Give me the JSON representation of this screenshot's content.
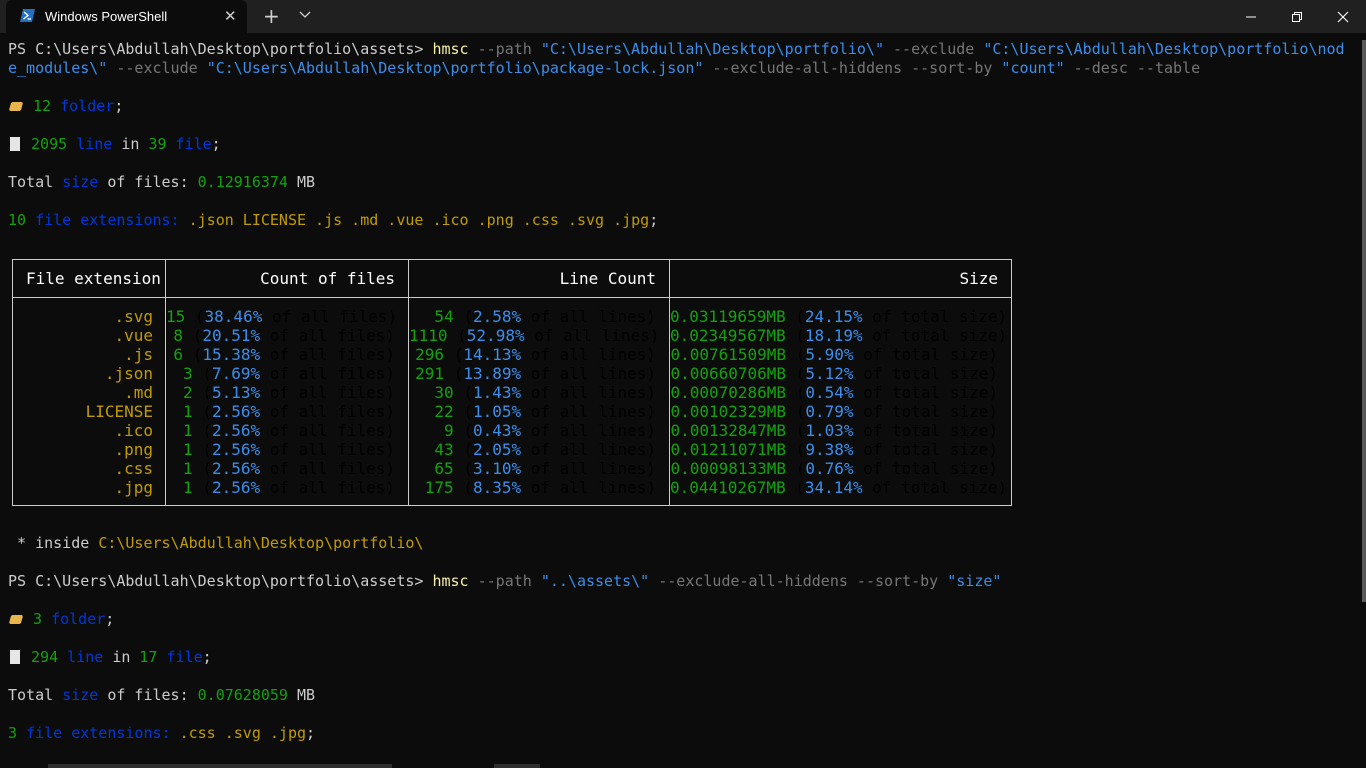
{
  "window": {
    "tab_title": "Windows PowerShell",
    "tab_close": "✕",
    "new_tab": "+",
    "accent": "#0c0c0c"
  },
  "cmd1": {
    "prompt": "PS C:\\Users\\Abdullah\\Desktop\\portfolio\\assets>",
    "command": "hmsc",
    "p1": "--path",
    "v1": "\"C:\\Users\\Abdullah\\Desktop\\portfolio\\\"",
    "p2": "--exclude",
    "v2a": "\"C:\\Users\\Abdullah\\Desktop\\portfolio\\nod",
    "v2b": "e_modules\\\"",
    "p3": "--exclude",
    "v3": "\"C:\\Users\\Abdullah\\Desktop\\portfolio\\package-lock.json\"",
    "p4": "--exclude-all-hiddens --sort-by",
    "v4": "\"count\"",
    "p5": "--desc --table"
  },
  "out1": {
    "folders_count": "12",
    "folders_word": "folder",
    "lines_count": "2095",
    "lines_word": "line",
    "in_word": "in",
    "files_count": "39",
    "files_word": "file",
    "total_a": "Total",
    "total_size_word": "size",
    "total_b": "of files:",
    "total_value": "0.12916374",
    "total_unit": "MB",
    "ext_count": "10",
    "ext_label": "file extensions:",
    "ext_list": ".json LICENSE .js .md .vue .ico .png .css .svg .jpg"
  },
  "table": {
    "headers": [
      "File extension",
      "Count of files",
      "Line Count",
      "Size"
    ],
    "rows": [
      {
        "ext": ".svg",
        "count": "15",
        "count_pct": "38.46%",
        "lines": "54",
        "lines_pct": "2.58%",
        "size": "0.03119659MB",
        "size_pct": "24.15%"
      },
      {
        "ext": ".vue",
        "count": "8",
        "count_pct": "20.51%",
        "lines": "1110",
        "lines_pct": "52.98%",
        "size": "0.02349567MB",
        "size_pct": "18.19%"
      },
      {
        "ext": ".js",
        "count": "6",
        "count_pct": "15.38%",
        "lines": "296",
        "lines_pct": "14.13%",
        "size": "0.00761509MB",
        "size_pct": "5.90%"
      },
      {
        "ext": ".json",
        "count": "3",
        "count_pct": "7.69%",
        "lines": "291",
        "lines_pct": "13.89%",
        "size": "0.00660706MB",
        "size_pct": "5.12%"
      },
      {
        "ext": ".md",
        "count": "2",
        "count_pct": "5.13%",
        "lines": "30",
        "lines_pct": "1.43%",
        "size": "0.00070286MB",
        "size_pct": "0.54%"
      },
      {
        "ext": "LICENSE",
        "count": "1",
        "count_pct": "2.56%",
        "lines": "22",
        "lines_pct": "1.05%",
        "size": "0.00102329MB",
        "size_pct": "0.79%"
      },
      {
        "ext": ".ico",
        "count": "1",
        "count_pct": "2.56%",
        "lines": "9",
        "lines_pct": "0.43%",
        "size": "0.00132847MB",
        "size_pct": "1.03%"
      },
      {
        "ext": ".png",
        "count": "1",
        "count_pct": "2.56%",
        "lines": "43",
        "lines_pct": "2.05%",
        "size": "0.01211071MB",
        "size_pct": "9.38%"
      },
      {
        "ext": ".css",
        "count": "1",
        "count_pct": "2.56%",
        "lines": "65",
        "lines_pct": "3.10%",
        "size": "0.00098133MB",
        "size_pct": "0.76%"
      },
      {
        "ext": ".jpg",
        "count": "1",
        "count_pct": "2.56%",
        "lines": "175",
        "lines_pct": "8.35%",
        "size": "0.04410267MB",
        "size_pct": "34.14%"
      }
    ],
    "of_all_files": "of all files)",
    "of_all_lines": "of all lines)",
    "of_total_size": "of total size)"
  },
  "inside": {
    "star": "*",
    "label": "inside",
    "path": "C:\\Users\\Abdullah\\Desktop\\portfolio\\"
  },
  "cmd2": {
    "prompt": "PS C:\\Users\\Abdullah\\Desktop\\portfolio\\assets>",
    "command": "hmsc",
    "p1": "--path",
    "v1": "\"..\\assets\\\"",
    "p2": "--exclude-all-hiddens --sort-by",
    "v2": "\"size\""
  },
  "out2": {
    "folders_count": "3",
    "folders_word": "folder",
    "lines_count": "294",
    "lines_word": "line",
    "in_word": "in",
    "files_count": "17",
    "files_word": "file",
    "total_a": "Total",
    "total_size_word": "size",
    "total_b": "of files:",
    "total_value": "0.07628059",
    "total_unit": "MB",
    "ext_count": "3",
    "ext_label": "file extensions:",
    "ext_list": ".css .svg .jpg"
  }
}
